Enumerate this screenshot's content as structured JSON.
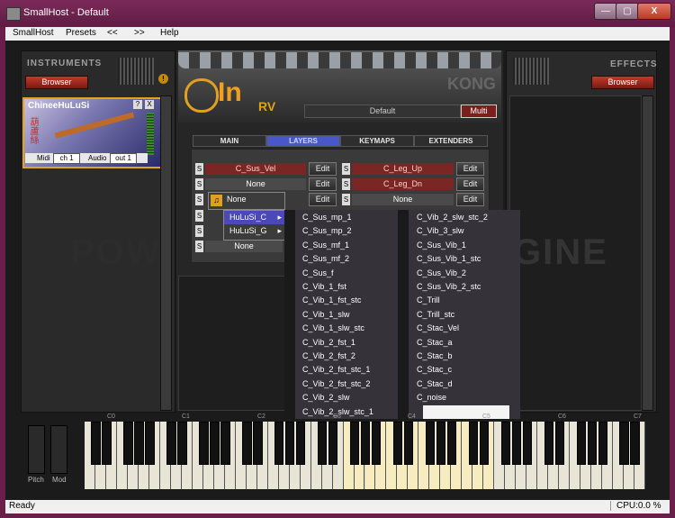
{
  "window": {
    "title": "SmallHost - Default"
  },
  "titlebar_buttons": {
    "minimize": "—",
    "maximize": "▢",
    "close": "X"
  },
  "menu": {
    "items": [
      "SmallHost",
      "Presets",
      "<<",
      ">>",
      "Help"
    ]
  },
  "instruments": {
    "title": "INSTRUMENTS",
    "browser": "Browser",
    "slot": {
      "name": "ChineeHuLuSi",
      "help": "?",
      "close": "X",
      "midi_label": "Midi",
      "midi_value": "ch 1",
      "audio_label": "Audio",
      "audio_value": "out 1",
      "calligraphy": "葫蘆絲"
    }
  },
  "effects": {
    "title": "EFFECTS",
    "browser": "Browser"
  },
  "kontakt": {
    "logo": "In",
    "logo_suffix": "RV",
    "brand": "KONG",
    "preset": "Default",
    "multi": "Multi",
    "tabs": [
      "MAIN",
      "LAYERS",
      "KEYMAPS",
      "EXTENDERS"
    ],
    "watermark_left": "POW",
    "watermark_right": "GINE"
  },
  "layers": {
    "left": [
      {
        "s": "S",
        "name": "C_Sus_Vel",
        "edit": "Edit"
      },
      {
        "s": "S",
        "name": "None",
        "edit": "Edit"
      },
      {
        "s": "S",
        "name": "None",
        "edit": "Edit"
      },
      {
        "s": "S",
        "name": "",
        "edit": ""
      },
      {
        "s": "S",
        "name": "",
        "edit": ""
      },
      {
        "s": "S",
        "name": "None",
        "edit": ""
      }
    ],
    "right": [
      {
        "s": "S",
        "name": "C_Leg_Up",
        "edit": "Edit"
      },
      {
        "s": "S",
        "name": "C_Leg_Dn",
        "edit": "Edit"
      },
      {
        "s": "S",
        "name": "None",
        "edit": "Edit"
      },
      {
        "s": "S",
        "name": "",
        "edit": ""
      },
      {
        "s": "S",
        "name": "",
        "edit": ""
      },
      {
        "s": "S",
        "name": "",
        "edit": ""
      }
    ]
  },
  "dropdown": {
    "header": "None",
    "submenu": [
      "HuLuSi_C",
      "HuLuSi_G"
    ],
    "col1": [
      "C_Sus_mp_1",
      "C_Sus_mp_2",
      "C_Sus_mf_1",
      "C_Sus_mf_2",
      "C_Sus_f",
      "C_Vib_1_fst",
      "C_Vib_1_fst_stc",
      "C_Vib_1_slw",
      "C_Vib_1_slw_stc",
      "C_Vib_2_fst_1",
      "C_Vib_2_fst_2",
      "C_Vib_2_fst_stc_1",
      "C_Vib_2_fst_stc_2",
      "C_Vib_2_slw",
      "C_Vib_2_slw_stc_1"
    ],
    "col2": [
      "C_Vib_2_slw_stc_2",
      "C_Vib_3_slw",
      "C_Sus_Vib_1",
      "C_Sus_Vib_1_stc",
      "C_Sus_Vib_2",
      "C_Sus_Vib_2_stc",
      "C_Trill",
      "C_Trill_stc",
      "C_Stac_Vel",
      "C_Stac_a",
      "C_Stac_b",
      "C_Stac_c",
      "C_Stac_d",
      "C_noise"
    ]
  },
  "keyboard": {
    "octaves": [
      "C0",
      "C1",
      "C2",
      "C3",
      "C4",
      "C5",
      "C6",
      "C7"
    ],
    "pitch": "Pitch",
    "mod": "Mod"
  },
  "status": {
    "text": "Ready",
    "cpu": "CPU:0.0 %"
  }
}
